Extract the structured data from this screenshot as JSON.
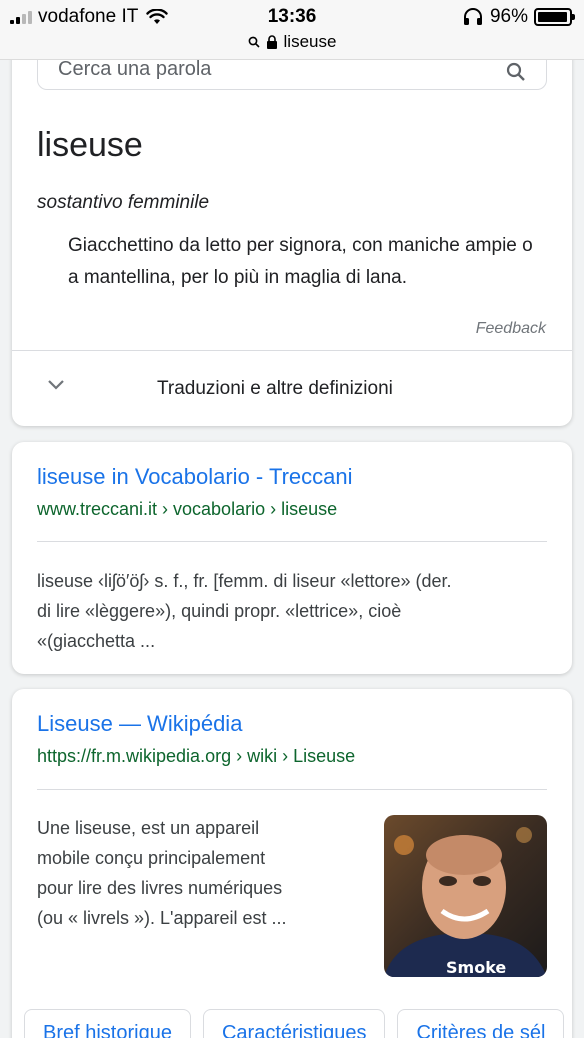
{
  "status_bar": {
    "carrier": "vodafone IT",
    "time": "13:36",
    "url": "liseuse",
    "battery": "96%",
    "battery_level": 0.96
  },
  "dictionary": {
    "search_placeholder": "Cerca una parola",
    "word": "liseuse",
    "part_of_speech": "sostantivo femminile",
    "definition": "Giacchettino da letto per signora, con maniche ampie o a mantellina, per lo più in maglia di lana.",
    "feedback": "Feedback",
    "more_label": "Traduzioni e altre definizioni"
  },
  "results": [
    {
      "title": "liseuse in Vocabolario - Treccani",
      "url": "www.treccani.it › vocabolario › liseuse",
      "snippet_lines": [
        "liseuse ‹liʃö′öʃ› s. f., fr. [femm. di liseur «lettore» (der.",
        "di lire «lèggere»), quindi propr. «lettrice», cioè",
        "«(giacchetta ..."
      ]
    },
    {
      "title": "Liseuse — Wikipédia",
      "url": "https://fr.m.wikipedia.org › wiki › Liseuse",
      "snippet_lines": [
        "Une liseuse, est un appareil",
        "mobile conçu principalement",
        "pour lire des livres numériques",
        "(ou « livrels »). L'appareil est ..."
      ],
      "chips": [
        "Bref historique",
        "Caractéristiques",
        "Critères de sél"
      ]
    }
  ],
  "colors": {
    "link": "#1a73e8",
    "url_green": "#0d652d",
    "background": "#f1f3f4"
  }
}
